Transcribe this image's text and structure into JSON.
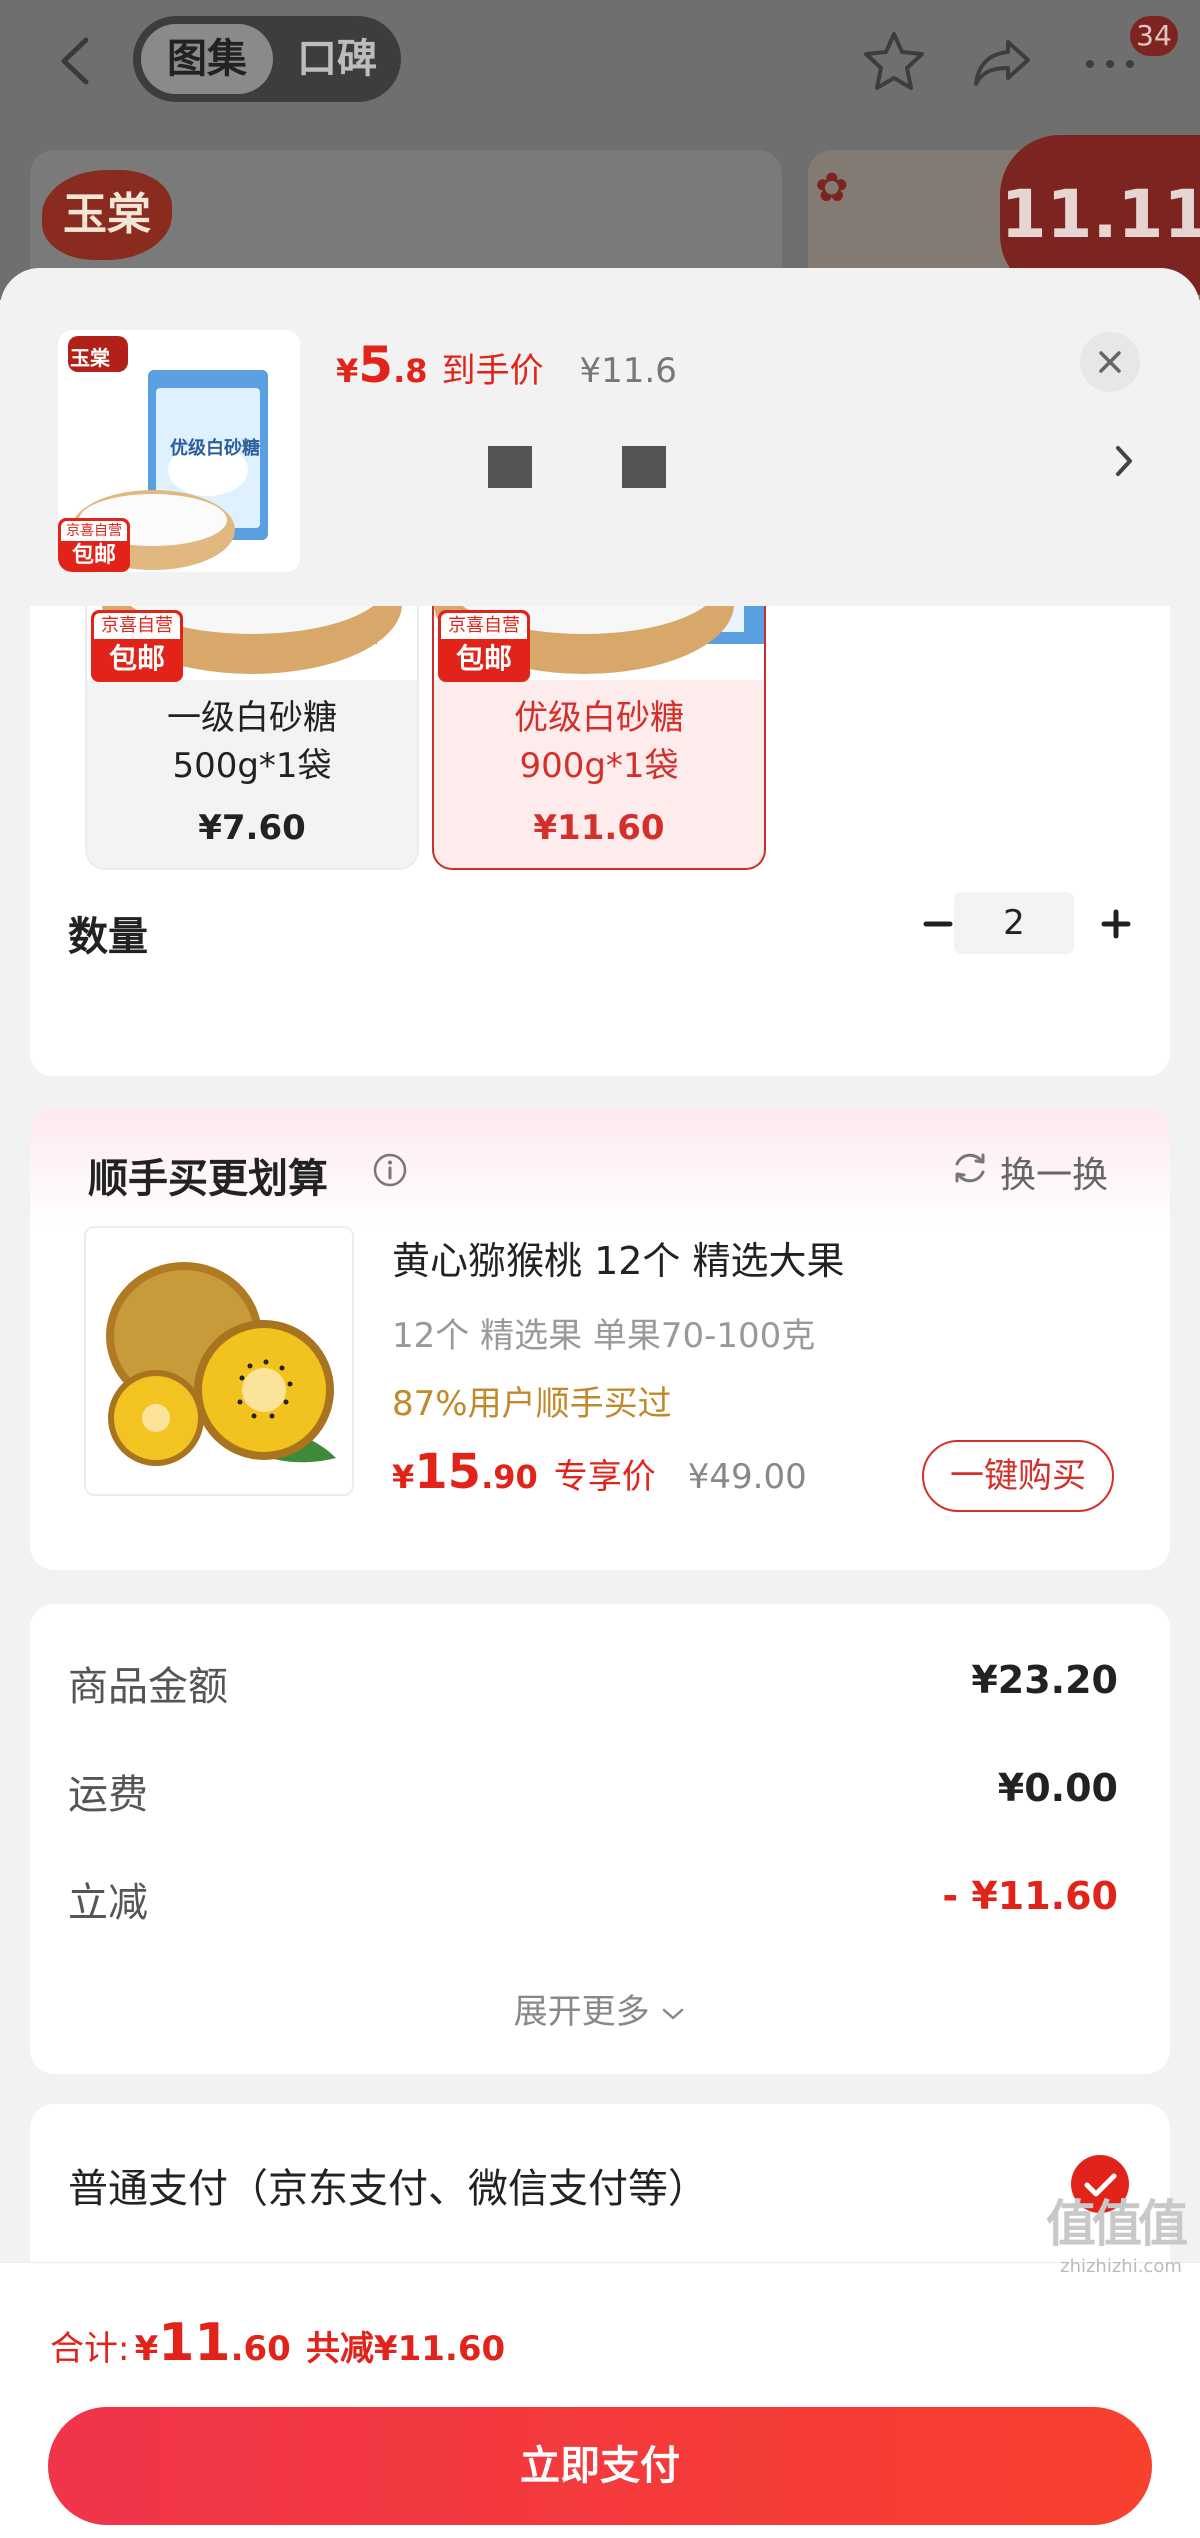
{
  "header": {
    "tabs": [
      "图集",
      "口碑"
    ],
    "active_tab": "图集",
    "badge": "34",
    "bg_logo": "玉棠",
    "bg_promo": "11.11",
    "icons": [
      "back-icon",
      "star-icon",
      "share-icon",
      "more-icon"
    ]
  },
  "product": {
    "yen": "¥",
    "price_int": "5",
    "price_dec": ".8",
    "price_label": "到手价",
    "orig_price": "¥11.6",
    "thumb_brand": "玉棠",
    "thumb_package": "优级白砂糖",
    "thumb_tag_top": "京喜自营",
    "thumb_tag": "包邮"
  },
  "specs": [
    {
      "name": "一级白砂糖",
      "weight": "500g*1袋",
      "price": "¥7.60",
      "tag_top": "京喜自营",
      "tag": "包邮",
      "selected": false
    },
    {
      "name": "优级白砂糖",
      "weight": "900g*1袋",
      "price": "¥11.60",
      "tag_top": "京喜自营",
      "tag": "包邮",
      "selected": true
    }
  ],
  "quantity": {
    "label": "数量",
    "value": "2",
    "minus": "−",
    "plus": "+"
  },
  "addon": {
    "title": "顺手买更划算",
    "refresh_label": "换一换",
    "name": "黄心猕猴桃 12个 精选大果",
    "desc": "12个 精选果 单果70-100克",
    "percent": "87%用户顺手买过",
    "yen": "¥",
    "price_int": "15",
    "price_dec": ".90",
    "price_label": "专享价",
    "orig_price": "¥49.00",
    "buy_label": "一键购买"
  },
  "summary": {
    "rows": [
      {
        "label": "商品金额",
        "value": "¥23.20"
      },
      {
        "label": "运费",
        "value": "¥0.00"
      },
      {
        "label": "立减",
        "value": "- ¥11.60"
      }
    ],
    "expand_label": "展开更多"
  },
  "payment": {
    "option_label": "普通支付（京东支付、微信支付等）",
    "checked": true
  },
  "footer": {
    "total_label": "合计:",
    "yen": "¥",
    "total_int": "11",
    "total_dec": ".60",
    "saved": "共减¥11.60",
    "pay_button": "立即支付",
    "watermark": "值值值",
    "watermark_url": "zhizhizhi.com"
  },
  "colors": {
    "accent": "#e2231a",
    "gold": "#c0892a",
    "pay_button": "#f23a3c"
  }
}
